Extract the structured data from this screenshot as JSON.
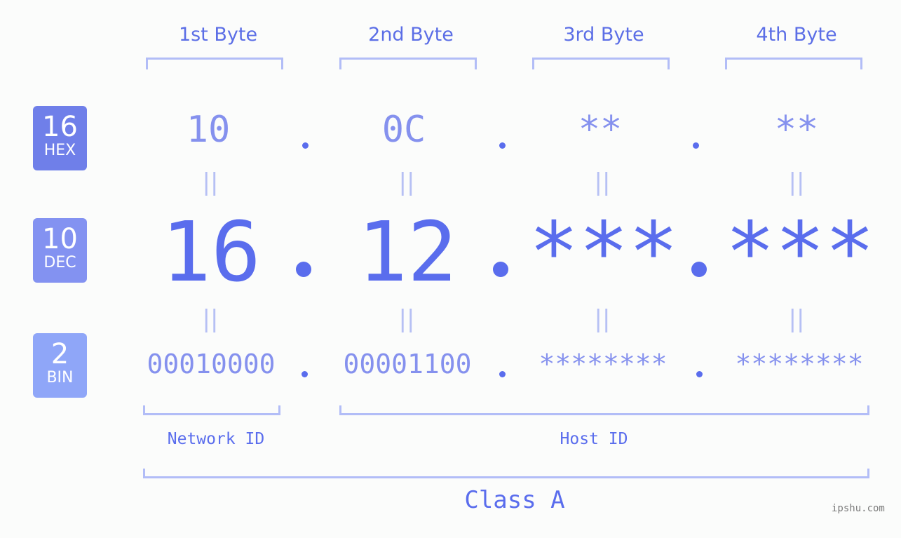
{
  "bytes": [
    "1st Byte",
    "2nd Byte",
    "3rd Byte",
    "4th Byte"
  ],
  "badges": {
    "hex": {
      "num": "16",
      "label": "HEX",
      "color": "#6f7fe9"
    },
    "dec": {
      "num": "10",
      "label": "DEC",
      "color": "#8392f1"
    },
    "bin": {
      "num": "2",
      "label": "BIN",
      "color": "#8fa6f8"
    }
  },
  "hex_values": [
    "10",
    "0C",
    "**",
    "**"
  ],
  "dec_values": [
    "16",
    "12",
    "***",
    "***"
  ],
  "bin_values": [
    "00010000",
    "00001100",
    "********",
    "********"
  ],
  "equals_sign": "||",
  "network_id_label": "Network ID",
  "host_id_label": "Host ID",
  "class_label": "Class A",
  "watermark": "ipshu.com"
}
